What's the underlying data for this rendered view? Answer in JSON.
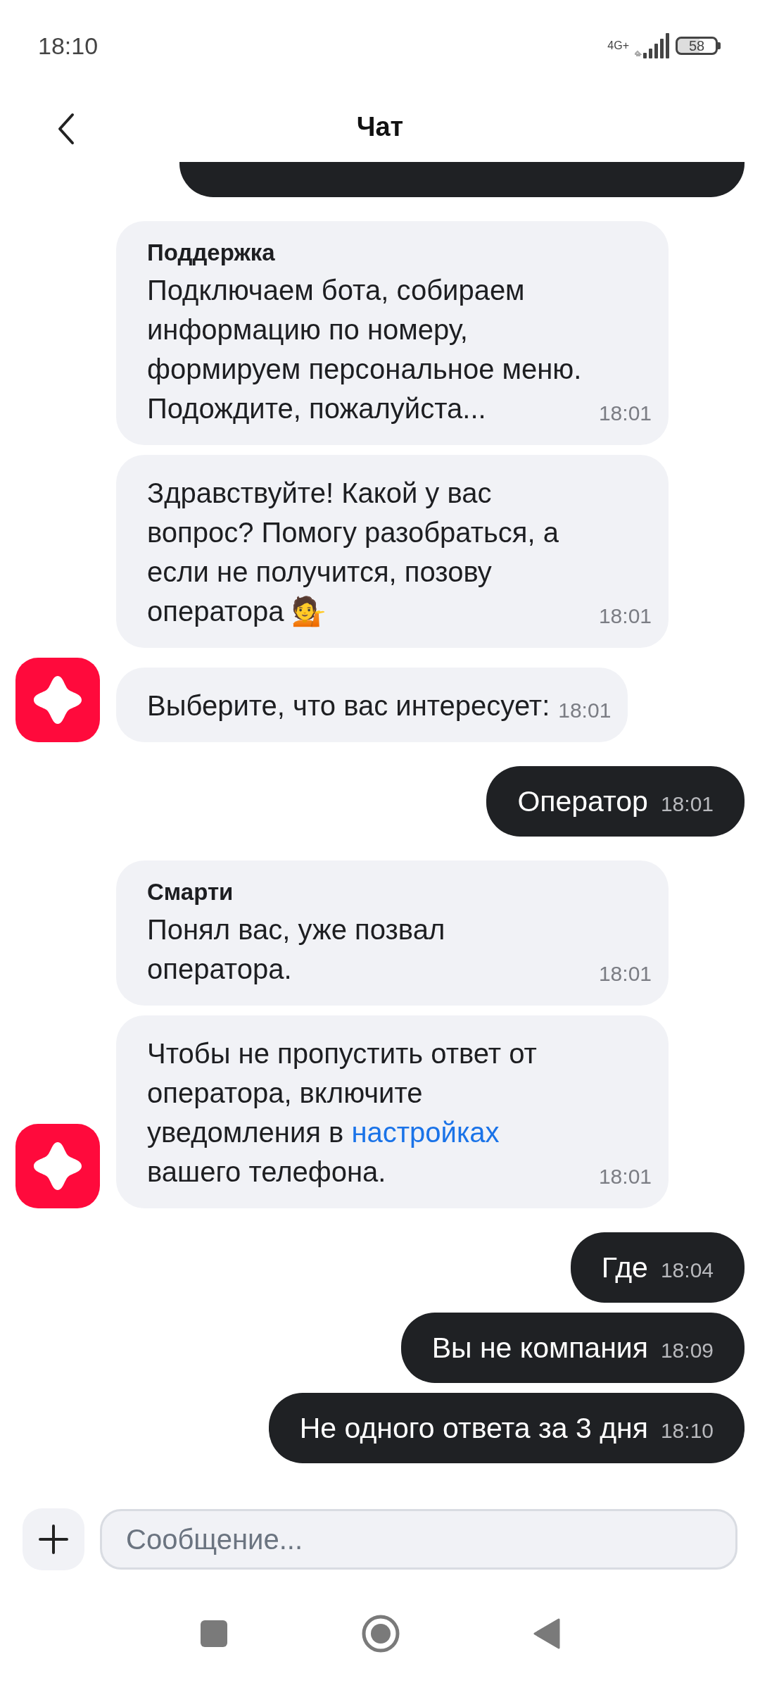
{
  "status_bar": {
    "time": "18:10",
    "network": "4G+",
    "battery": "58"
  },
  "header": {
    "title": "Чат"
  },
  "messages": [
    {
      "kind": "incoming",
      "sender": "Поддержка",
      "parts": [
        {
          "kind": "text",
          "text": "Подключаем бота, собираем информацию по номеру, формируем персональное меню. Подождите, пожалуйста..."
        }
      ],
      "time": "18:01",
      "avatar": false
    },
    {
      "kind": "incoming",
      "parts": [
        {
          "kind": "text",
          "text": "Здравствуйте! Какой у вас вопрос? Помогу разобраться, а если не получится, позову оператора 💁"
        }
      ],
      "time": "18:01",
      "avatar": false
    },
    {
      "kind": "incoming",
      "parts": [
        {
          "kind": "text",
          "text": "Выберите, что вас интересует:"
        }
      ],
      "time": "18:01",
      "avatar": true
    },
    {
      "kind": "outgoing",
      "parts": [
        {
          "kind": "text",
          "text": "Оператор"
        }
      ],
      "time": "18:01",
      "avatar": false
    },
    {
      "kind": "incoming",
      "sender": "Смарти",
      "parts": [
        {
          "kind": "text",
          "text": "Понял вас, уже позвал оператора."
        }
      ],
      "time": "18:01",
      "avatar": false
    },
    {
      "kind": "incoming",
      "parts": [
        {
          "kind": "text",
          "text": "Чтобы не пропустить ответ от оператора, включите уведомления в "
        },
        {
          "kind": "link",
          "text": "настройках"
        },
        {
          "kind": "text",
          "text": " вашего телефона."
        }
      ],
      "time": "18:01",
      "avatar": true
    },
    {
      "kind": "outgoing",
      "parts": [
        {
          "kind": "text",
          "text": "Где"
        }
      ],
      "time": "18:04",
      "avatar": false
    },
    {
      "kind": "outgoing",
      "parts": [
        {
          "kind": "text",
          "text": "Вы не компания"
        }
      ],
      "time": "18:09",
      "avatar": false
    },
    {
      "kind": "outgoing",
      "parts": [
        {
          "kind": "text",
          "text": "Не одного ответа за 3 дня"
        }
      ],
      "time": "18:10",
      "avatar": false
    }
  ],
  "composer": {
    "placeholder": "Сообщение..."
  }
}
